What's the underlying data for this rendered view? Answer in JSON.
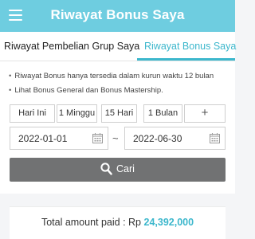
{
  "header": {
    "title": "Riwayat Bonus Saya",
    "menu_icon": "hamburger-icon",
    "bg_color": "#6ecde0"
  },
  "tabs": [
    {
      "label": "Riwayat Pembelian Grup Saya",
      "active": false
    },
    {
      "label": "Riwayat Bonus Saya",
      "active": true
    }
  ],
  "notes": [
    "Riwayat Bonus hanya tersedia dalam kurun waktu 12 bulan",
    "Lihat Bonus General dan Bonus Mastership."
  ],
  "range_buttons": [
    "Hari Ini",
    "1 Minggu",
    "15 Hari",
    "1 Bulan",
    "+"
  ],
  "date_range": {
    "start": "2022-01-01",
    "separator": "~",
    "end": "2022-06-30",
    "icon": "calendar-icon"
  },
  "search": {
    "label": "Cari",
    "icon": "search-icon"
  },
  "total": {
    "label": "Total amount paid : Rp",
    "amount": "24,392,000"
  },
  "colors": {
    "accent": "#3cb7cc",
    "search_button": "#717273"
  }
}
